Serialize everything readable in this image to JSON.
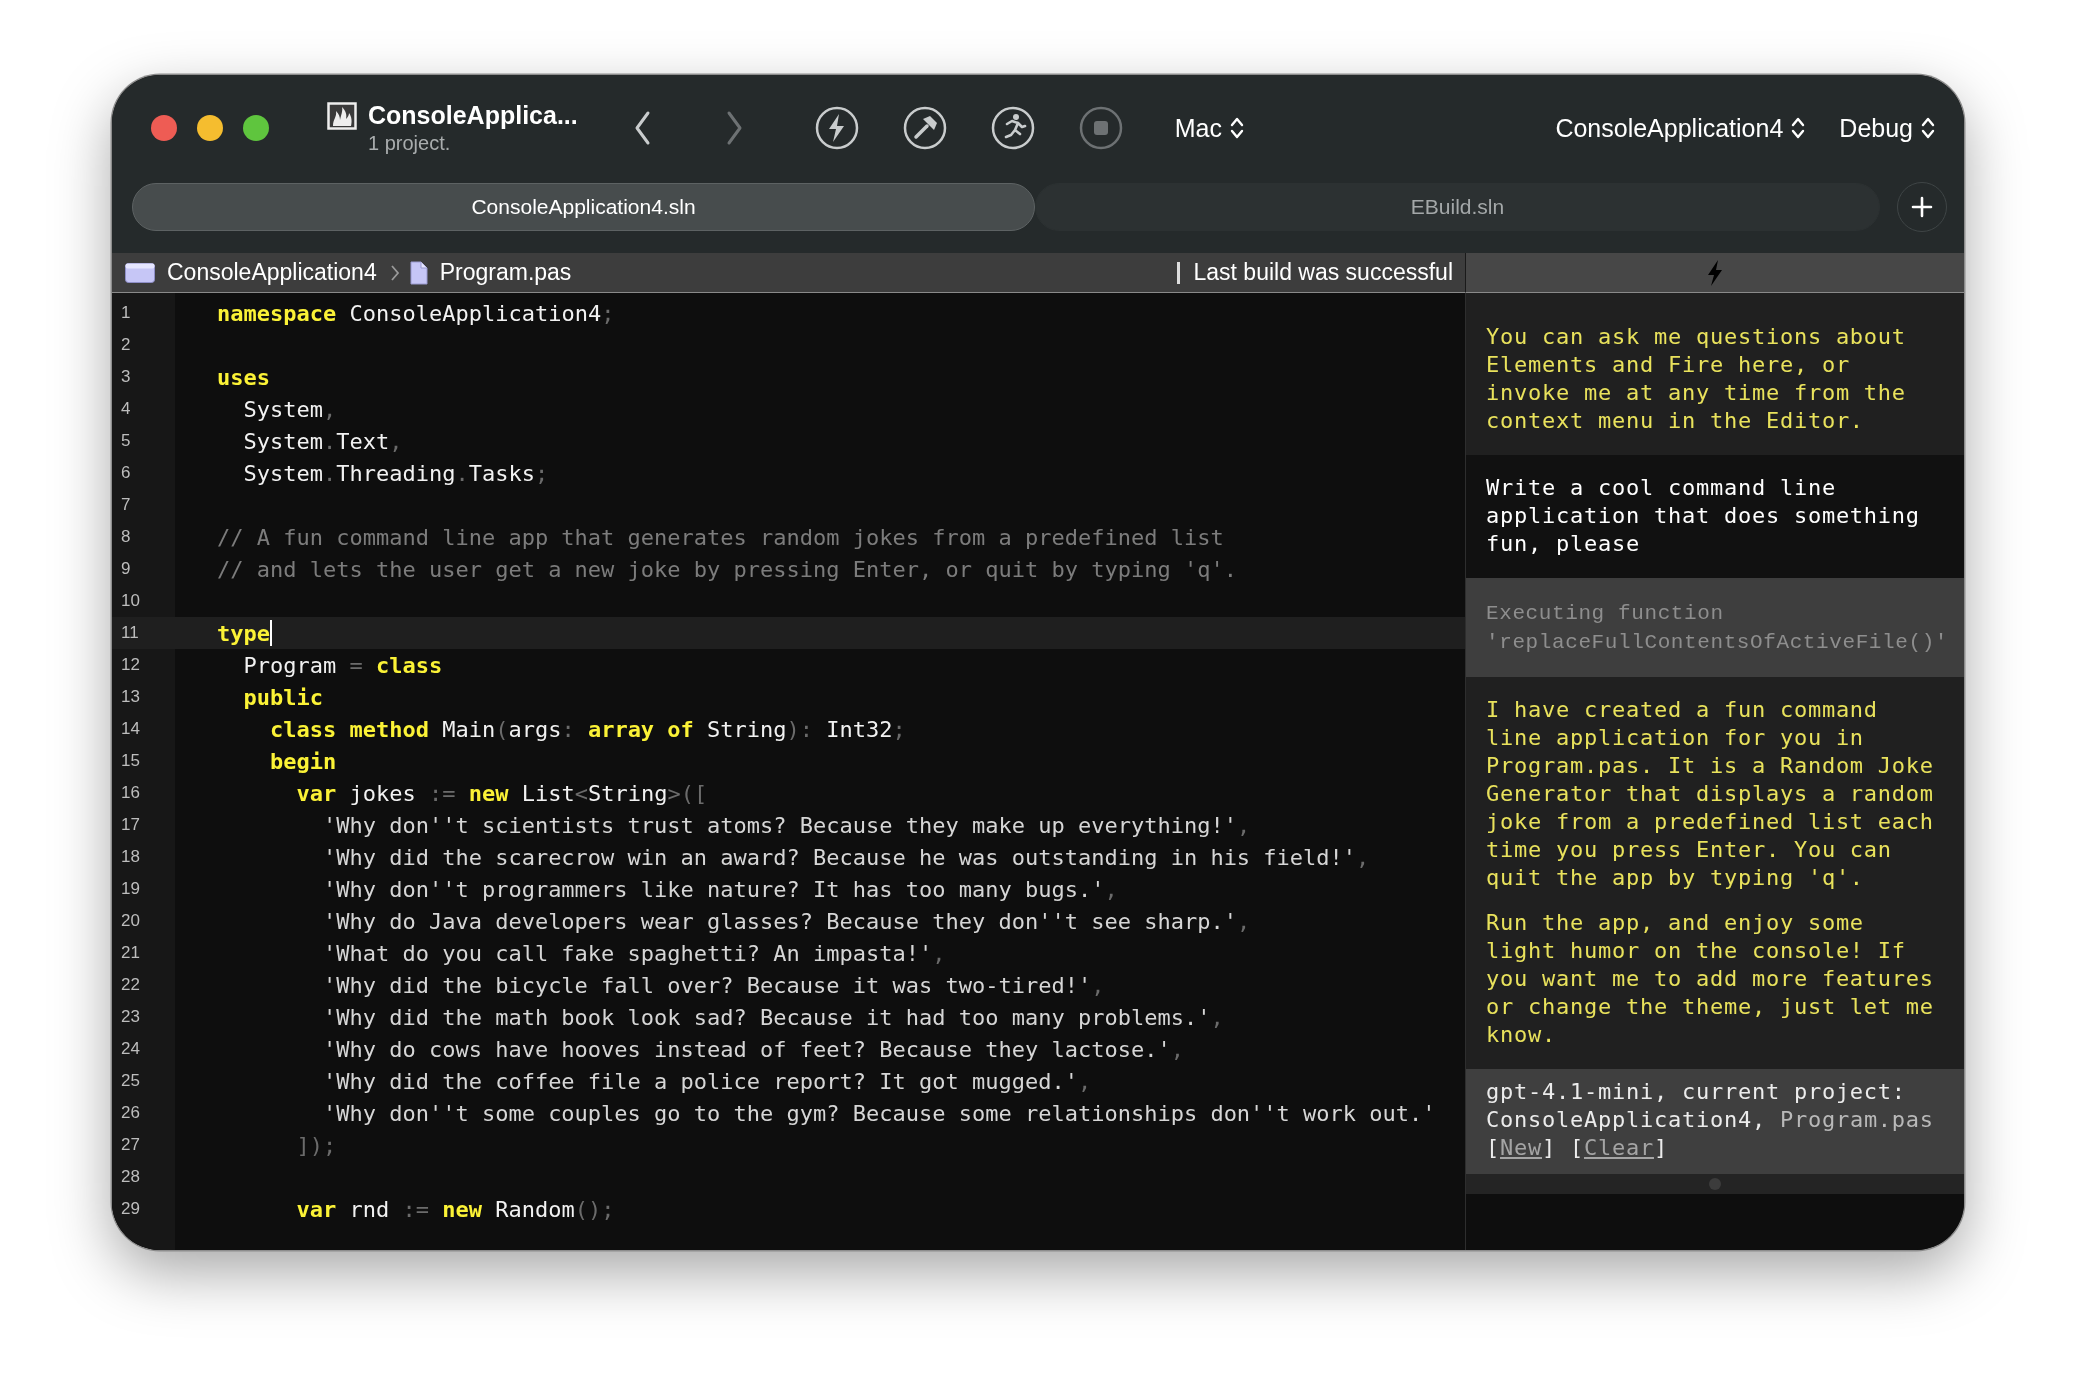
{
  "window": {
    "title": "ConsoleApplica...",
    "subtitle": "1 project."
  },
  "toolbar": {
    "nav": [
      {
        "kind": "back",
        "disabled": false
      },
      {
        "kind": "forward",
        "disabled": true
      }
    ],
    "actions": [
      {
        "kind": "bolt",
        "disabled": false
      },
      {
        "kind": "hammer",
        "disabled": false
      },
      {
        "kind": "run",
        "disabled": false
      },
      {
        "kind": "stop",
        "disabled": true
      }
    ],
    "device": "Mac",
    "scheme": "ConsoleApplication4",
    "configuration": "Debug"
  },
  "tabs": [
    {
      "label": "ConsoleApplication4.sln",
      "selected": true
    },
    {
      "label": "EBuild.sln",
      "selected": false
    }
  ],
  "breadcrumb": [
    {
      "kind": "project",
      "label": "ConsoleApplication4"
    },
    {
      "kind": "file",
      "label": "Program.pas"
    }
  ],
  "build_status": "Last build was successful",
  "editor": {
    "lines": [
      {
        "number": "1",
        "current": false,
        "tokens": [
          {
            "kind": "keyword",
            "text": "namespace"
          },
          {
            "kind": "ident",
            "text": " ConsoleApplication4"
          },
          {
            "kind": "punct",
            "text": ";"
          }
        ]
      },
      {
        "number": "2",
        "current": false
      },
      {
        "number": "3",
        "current": false,
        "tokens": [
          {
            "kind": "keyword",
            "text": "uses"
          }
        ]
      },
      {
        "number": "4",
        "current": false,
        "tokens": [
          {
            "kind": "ident",
            "text": "  System"
          },
          {
            "kind": "punct",
            "text": ","
          }
        ]
      },
      {
        "number": "5",
        "current": false,
        "tokens": [
          {
            "kind": "ident",
            "text": "  System"
          },
          {
            "kind": "punct",
            "text": "."
          },
          {
            "kind": "ident",
            "text": "Text"
          },
          {
            "kind": "punct",
            "text": ","
          }
        ]
      },
      {
        "number": "6",
        "current": false,
        "tokens": [
          {
            "kind": "ident",
            "text": "  System"
          },
          {
            "kind": "punct",
            "text": "."
          },
          {
            "kind": "ident",
            "text": "Threading"
          },
          {
            "kind": "punct",
            "text": "."
          },
          {
            "kind": "ident",
            "text": "Tasks"
          },
          {
            "kind": "punct",
            "text": ";"
          }
        ]
      },
      {
        "number": "7",
        "current": false
      },
      {
        "number": "8",
        "current": false,
        "tokens": [
          {
            "kind": "comment",
            "text": "// A fun command line app that generates random jokes from a predefined list"
          }
        ]
      },
      {
        "number": "9",
        "current": false,
        "tokens": [
          {
            "kind": "comment",
            "text": "// and lets the user get a new joke by pressing Enter, or quit by typing 'q'."
          }
        ]
      },
      {
        "number": "10",
        "current": false
      },
      {
        "number": "11",
        "current": true,
        "tokens": [
          {
            "kind": "keyword",
            "text": "type"
          }
        ]
      },
      {
        "number": "12",
        "current": false,
        "tokens": [
          {
            "kind": "ident",
            "text": "  Program "
          },
          {
            "kind": "punct",
            "text": "="
          },
          {
            "kind": "keyword",
            "text": " class"
          }
        ]
      },
      {
        "number": "13",
        "current": false,
        "tokens": [
          {
            "kind": "keyword",
            "text": "  public"
          }
        ]
      },
      {
        "number": "14",
        "current": false,
        "tokens": [
          {
            "kind": "keyword",
            "text": "    class method"
          },
          {
            "kind": "ident",
            "text": " Main"
          },
          {
            "kind": "punct",
            "text": "("
          },
          {
            "kind": "ident",
            "text": "args"
          },
          {
            "kind": "punct",
            "text": ": "
          },
          {
            "kind": "keyword",
            "text": "array of"
          },
          {
            "kind": "ident",
            "text": " String"
          },
          {
            "kind": "punct",
            "text": "): "
          },
          {
            "kind": "ident",
            "text": "Int32"
          },
          {
            "kind": "punct",
            "text": ";"
          }
        ]
      },
      {
        "number": "15",
        "current": false,
        "tokens": [
          {
            "kind": "keyword",
            "text": "    begin"
          }
        ]
      },
      {
        "number": "16",
        "current": false,
        "tokens": [
          {
            "kind": "keyword",
            "text": "      var"
          },
          {
            "kind": "ident",
            "text": " jokes "
          },
          {
            "kind": "punct",
            "text": ":="
          },
          {
            "kind": "keyword",
            "text": " new"
          },
          {
            "kind": "ident",
            "text": " List"
          },
          {
            "kind": "punct",
            "text": "<"
          },
          {
            "kind": "ident",
            "text": "String"
          },
          {
            "kind": "punct",
            "text": ">(["
          }
        ]
      },
      {
        "number": "17",
        "current": false,
        "tokens": [
          {
            "kind": "string",
            "text": "        'Why don''t scientists trust atoms? Because they make up everything!'"
          },
          {
            "kind": "punct",
            "text": ","
          }
        ]
      },
      {
        "number": "18",
        "current": false,
        "tokens": [
          {
            "kind": "string",
            "text": "        'Why did the scarecrow win an award? Because he was outstanding in his field!'"
          },
          {
            "kind": "punct",
            "text": ","
          }
        ]
      },
      {
        "number": "19",
        "current": false,
        "tokens": [
          {
            "kind": "string",
            "text": "        'Why don''t programmers like nature? It has too many bugs.'"
          },
          {
            "kind": "punct",
            "text": ","
          }
        ]
      },
      {
        "number": "20",
        "current": false,
        "tokens": [
          {
            "kind": "string",
            "text": "        'Why do Java developers wear glasses? Because they don''t see sharp.'"
          },
          {
            "kind": "punct",
            "text": ","
          }
        ]
      },
      {
        "number": "21",
        "current": false,
        "tokens": [
          {
            "kind": "string",
            "text": "        'What do you call fake spaghetti? An impasta!'"
          },
          {
            "kind": "punct",
            "text": ","
          }
        ]
      },
      {
        "number": "22",
        "current": false,
        "tokens": [
          {
            "kind": "string",
            "text": "        'Why did the bicycle fall over? Because it was two-tired!'"
          },
          {
            "kind": "punct",
            "text": ","
          }
        ]
      },
      {
        "number": "23",
        "current": false,
        "tokens": [
          {
            "kind": "string",
            "text": "        'Why did the math book look sad? Because it had too many problems.'"
          },
          {
            "kind": "punct",
            "text": ","
          }
        ]
      },
      {
        "number": "24",
        "current": false,
        "tokens": [
          {
            "kind": "string",
            "text": "        'Why do cows have hooves instead of feet? Because they lactose.'"
          },
          {
            "kind": "punct",
            "text": ","
          }
        ]
      },
      {
        "number": "25",
        "current": false,
        "tokens": [
          {
            "kind": "string",
            "text": "        'Why did the coffee file a police report? It got mugged.'"
          },
          {
            "kind": "punct",
            "text": ","
          }
        ]
      },
      {
        "number": "26",
        "current": false,
        "tokens": [
          {
            "kind": "string",
            "text": "        'Why don''t some couples go to the gym? Because some relationships don''t work out.'"
          }
        ]
      },
      {
        "number": "27",
        "current": false,
        "tokens": [
          {
            "kind": "punct",
            "text": "      ]);"
          }
        ]
      },
      {
        "number": "28",
        "current": false
      },
      {
        "number": "29",
        "current": false,
        "tokens": [
          {
            "kind": "keyword",
            "text": "      var"
          },
          {
            "kind": "ident",
            "text": " rnd "
          },
          {
            "kind": "punct",
            "text": ":="
          },
          {
            "kind": "keyword",
            "text": " new"
          },
          {
            "kind": "ident",
            "text": " Random"
          },
          {
            "kind": "punct",
            "text": "();"
          }
        ]
      }
    ]
  },
  "assistant": {
    "messages": [
      {
        "kind": "assistant",
        "paragraphs": [
          "You can ask me questions about Elements and Fire here, or invoke me at any time from the context menu in the Editor."
        ]
      },
      {
        "kind": "user",
        "paragraphs": [
          "Write a cool command line application that does something fun, please"
        ]
      },
      {
        "kind": "function",
        "paragraphs": [
          "Executing function 'replaceFullContentsOfActiveFile()'"
        ]
      },
      {
        "kind": "assistant",
        "paragraphs": [
          "I have created a fun command line application for you in Program.pas. It is a Random Joke Generator that displays a random joke from a predefined list each time you press Enter. You can quit the app by typing 'q'.",
          "Run the app, and enjoy some light humor on the console! If you want me to add more features or change the theme, just let me know."
        ]
      }
    ],
    "footer": {
      "text": "gpt-4.1-mini, current project: ConsoleApplication4,",
      "file": "Program.pas",
      "links": [
        {
          "open": "[",
          "label": "New",
          "close": "]"
        },
        {
          "open": "[",
          "label": "Clear",
          "close": "]"
        }
      ]
    }
  }
}
